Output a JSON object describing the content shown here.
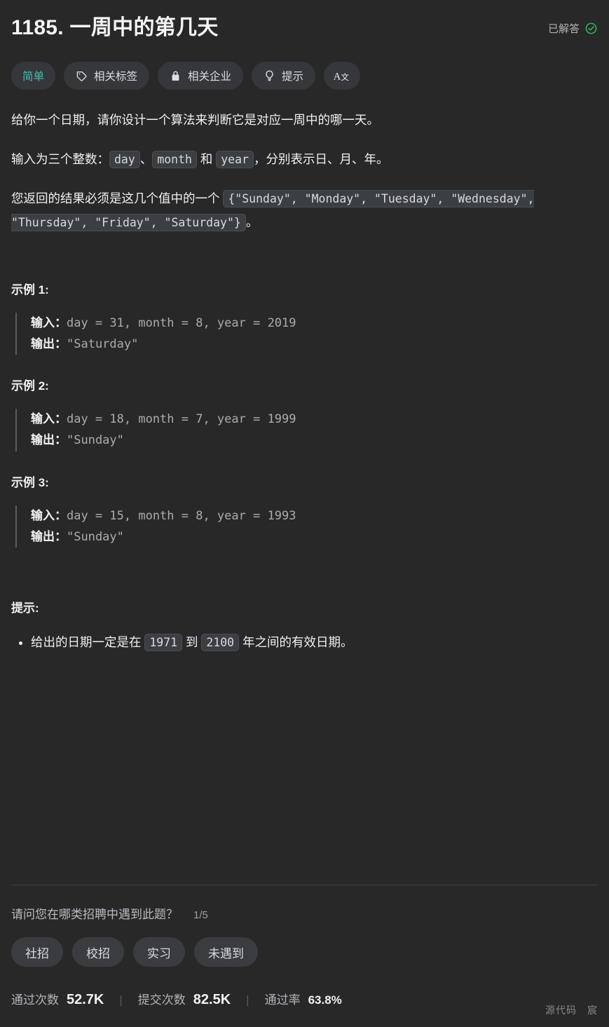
{
  "header": {
    "title": "1185. 一周中的第几天",
    "solved_label": "已解答",
    "solved_icon": "check-circle-icon",
    "accent_green": "#2db55d"
  },
  "pills": [
    {
      "label": "简单",
      "icon": null,
      "color": "#45bfae",
      "name": "difficulty-easy"
    },
    {
      "label": "相关标签",
      "icon": "tag-icon",
      "name": "related-tags"
    },
    {
      "label": "相关企业",
      "icon": "lock-icon",
      "name": "related-companies"
    },
    {
      "label": "提示",
      "icon": "lightbulb-icon",
      "name": "hints"
    },
    {
      "label": "",
      "icon": "translate-icon",
      "name": "translate"
    }
  ],
  "description": {
    "p1": "给你一个日期，请你设计一个算法来判断它是对应一周中的哪一天。",
    "p2_prefix": "输入为三个整数：",
    "p2_code1": "day",
    "p2_mid1": "、",
    "p2_code2": "month",
    "p2_mid2": " 和 ",
    "p2_code3": "year",
    "p2_suffix": "，分别表示日、月、年。",
    "p3_prefix": "您返回的结果必须是这几个值中的一个 ",
    "p3_code": "{\"Sunday\", \"Monday\", \"Tuesday\", \"Wednesday\", \"Thursday\", \"Friday\", \"Saturday\"}",
    "p3_suffix": "。"
  },
  "examples": [
    {
      "title": "示例 1:",
      "input_label": "输入：",
      "input_value": "day = 31, month = 8, year = 2019",
      "output_label": "输出：",
      "output_value": "\"Saturday\""
    },
    {
      "title": "示例 2:",
      "input_label": "输入：",
      "input_value": "day = 18, month = 7, year = 1999",
      "output_label": "输出：",
      "output_value": "\"Sunday\""
    },
    {
      "title": "示例 3:",
      "input_label": "输入：",
      "input_value": "day = 15, month = 8, year = 1993",
      "output_label": "输出：",
      "output_value": "\"Sunday\""
    }
  ],
  "hints": {
    "title": "提示:",
    "item_prefix": "给出的日期一定是在 ",
    "item_code1": "1971",
    "item_mid": " 到 ",
    "item_code2": "2100",
    "item_suffix": " 年之间的有效日期。"
  },
  "survey": {
    "question": "请问您在哪类招聘中遇到此题？",
    "counter": "1/5",
    "options": [
      "社招",
      "校招",
      "实习",
      "未遇到"
    ]
  },
  "stats": [
    {
      "label": "通过次数",
      "value": "52.7K",
      "small": false
    },
    {
      "label": "提交次数",
      "value": "82.5K",
      "small": false
    },
    {
      "label": "通过率",
      "value": "63.8%",
      "small": true
    }
  ],
  "watermark": "源代码　宸"
}
